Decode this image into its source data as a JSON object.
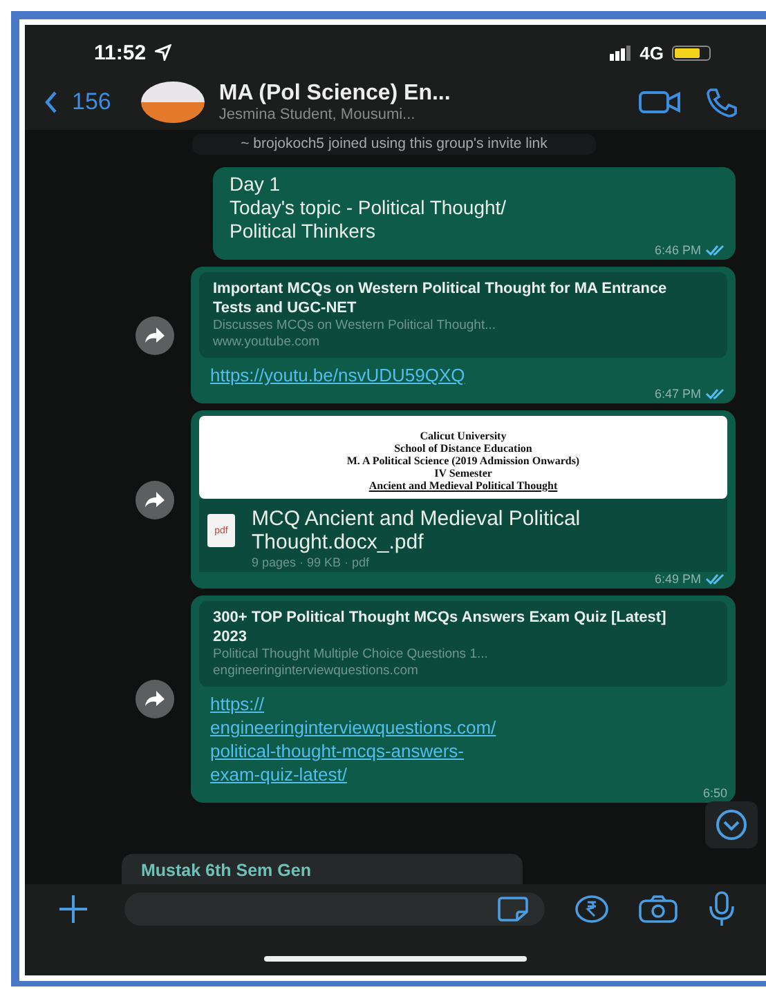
{
  "status_bar": {
    "time": "11:52",
    "network": "4G"
  },
  "header": {
    "back_count": "156",
    "title": "MA (Pol Science) En...",
    "subtitle": "Jesmina Student, Mousumi..."
  },
  "system_message": "~ brojokoch5 joined using this group's invite link",
  "messages": [
    {
      "kind": "text",
      "forward": false,
      "lines": [
        "Day 1",
        "Today's topic - Political Thought/",
        "Political Thinkers"
      ],
      "time": "6:46 PM",
      "read": true
    },
    {
      "kind": "link",
      "forward": true,
      "preview_title": "Important MCQs on Western Political Thought for MA Entrance Tests and UGC-NET",
      "preview_description": "Discusses MCQs on Western Political Thought...",
      "preview_domain": "www.youtube.com",
      "url": "https://youtu.be/nsvUDU59QXQ",
      "time": "6:47 PM",
      "read": true
    },
    {
      "kind": "document",
      "forward": true,
      "preview_lines": [
        "Calicut University",
        "School of Distance Education",
        "M. A Political Science (2019 Admission Onwards)",
        "IV Semester",
        "Ancient and Medieval Political Thought"
      ],
      "file_badge": "pdf",
      "file_name": "MCQ Ancient and Medieval Political Thought.docx_.pdf",
      "file_meta": "9 pages · 99 KB · pdf",
      "time": "6:49 PM",
      "read": true
    },
    {
      "kind": "link",
      "forward": true,
      "preview_title": "300+ TOP Political Thought MCQs Answers Exam Quiz [Latest] 2023",
      "preview_description": "Political Thought Multiple Choice Questions 1...",
      "preview_domain": "engineeringinterviewquestions.com",
      "url": "https://\nengineeringinterviewquestions.com/\npolitical-thought-mcqs-answers-\nexam-quiz-latest/",
      "time": "6:50"
    }
  ],
  "incoming_sender": "Mustak 6th Sem Gen"
}
